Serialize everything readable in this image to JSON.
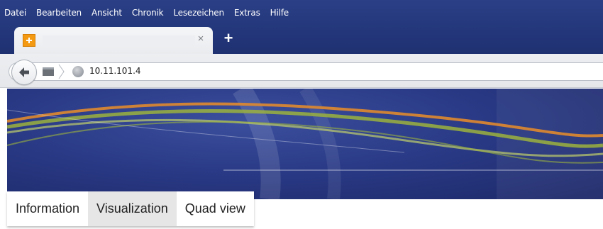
{
  "menubar": {
    "items": [
      {
        "label": "Datei"
      },
      {
        "label": "Bearbeiten"
      },
      {
        "label": "Ansicht"
      },
      {
        "label": "Chronik"
      },
      {
        "label": "Lesezeichen"
      },
      {
        "label": "Extras"
      },
      {
        "label": "Hilfe"
      }
    ]
  },
  "tab": {
    "favicon": "plus-box-icon",
    "title": "",
    "close_symbol": "×",
    "new_tab_symbol": "+"
  },
  "navbar": {
    "back_icon": "back-arrow-icon",
    "bookmarks_icon": "bookmarks-icon",
    "site_icon": "globe-icon",
    "url": "10.11.101.4"
  },
  "page": {
    "tabs": [
      {
        "label": "Information",
        "active": false
      },
      {
        "label": "Visualization",
        "active": true
      },
      {
        "label": "Quad view",
        "active": false
      }
    ]
  },
  "colors": {
    "chrome_blue": "#23367a",
    "banner_blue": "#2a3a86",
    "wave_orange": "#e08a2e",
    "wave_green": "#9bb23d",
    "tab_favicon": "#f39a12"
  }
}
